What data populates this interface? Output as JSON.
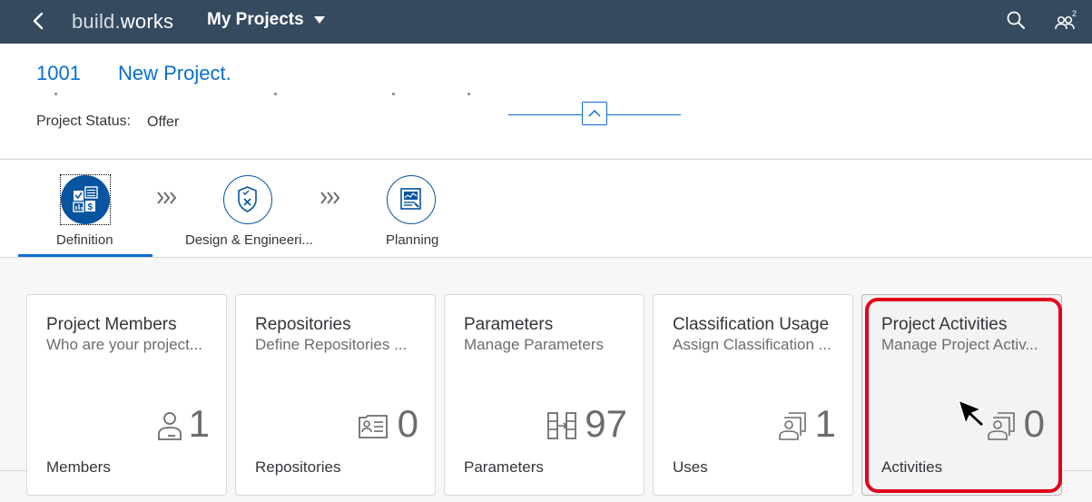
{
  "shell": {
    "logo_part1": "build.",
    "logo_part2": "works",
    "title": "My Projects"
  },
  "header": {
    "project_id": "1001",
    "project_name": "New Project.",
    "status_label": "Project Status:",
    "status_value": "Offer"
  },
  "process_flow": {
    "steps": [
      {
        "label": "Definition",
        "icon": "definition-icon",
        "selected": true
      },
      {
        "label": "Design & Engineeri...",
        "icon": "shield-check-icon",
        "selected": false
      },
      {
        "label": "Planning",
        "icon": "planning-board-icon",
        "selected": false
      }
    ]
  },
  "tiles": [
    {
      "title": "Project Members",
      "subtitle": "Who are your project...",
      "icon": "person-icon",
      "count": "1",
      "footer": "Members"
    },
    {
      "title": "Repositories",
      "subtitle": "Define Repositories ...",
      "icon": "id-card-icon",
      "count": "0",
      "footer": "Repositories"
    },
    {
      "title": "Parameters",
      "subtitle": "Manage Parameters",
      "icon": "parameters-icon",
      "count": "97",
      "footer": "Parameters"
    },
    {
      "title": "Classification Usage",
      "subtitle": "Assign Classification ...",
      "icon": "group-persons-icon",
      "count": "1",
      "footer": "Uses"
    },
    {
      "title": "Project Activities",
      "subtitle": "Manage Project Activ...",
      "icon": "group-persons-icon",
      "count": "0",
      "footer": "Activities"
    }
  ],
  "colors": {
    "shell_bg": "#354a5f",
    "link_blue": "#0a6ed1",
    "step_blue": "#0854a0",
    "highlight_red": "#e3001b"
  }
}
